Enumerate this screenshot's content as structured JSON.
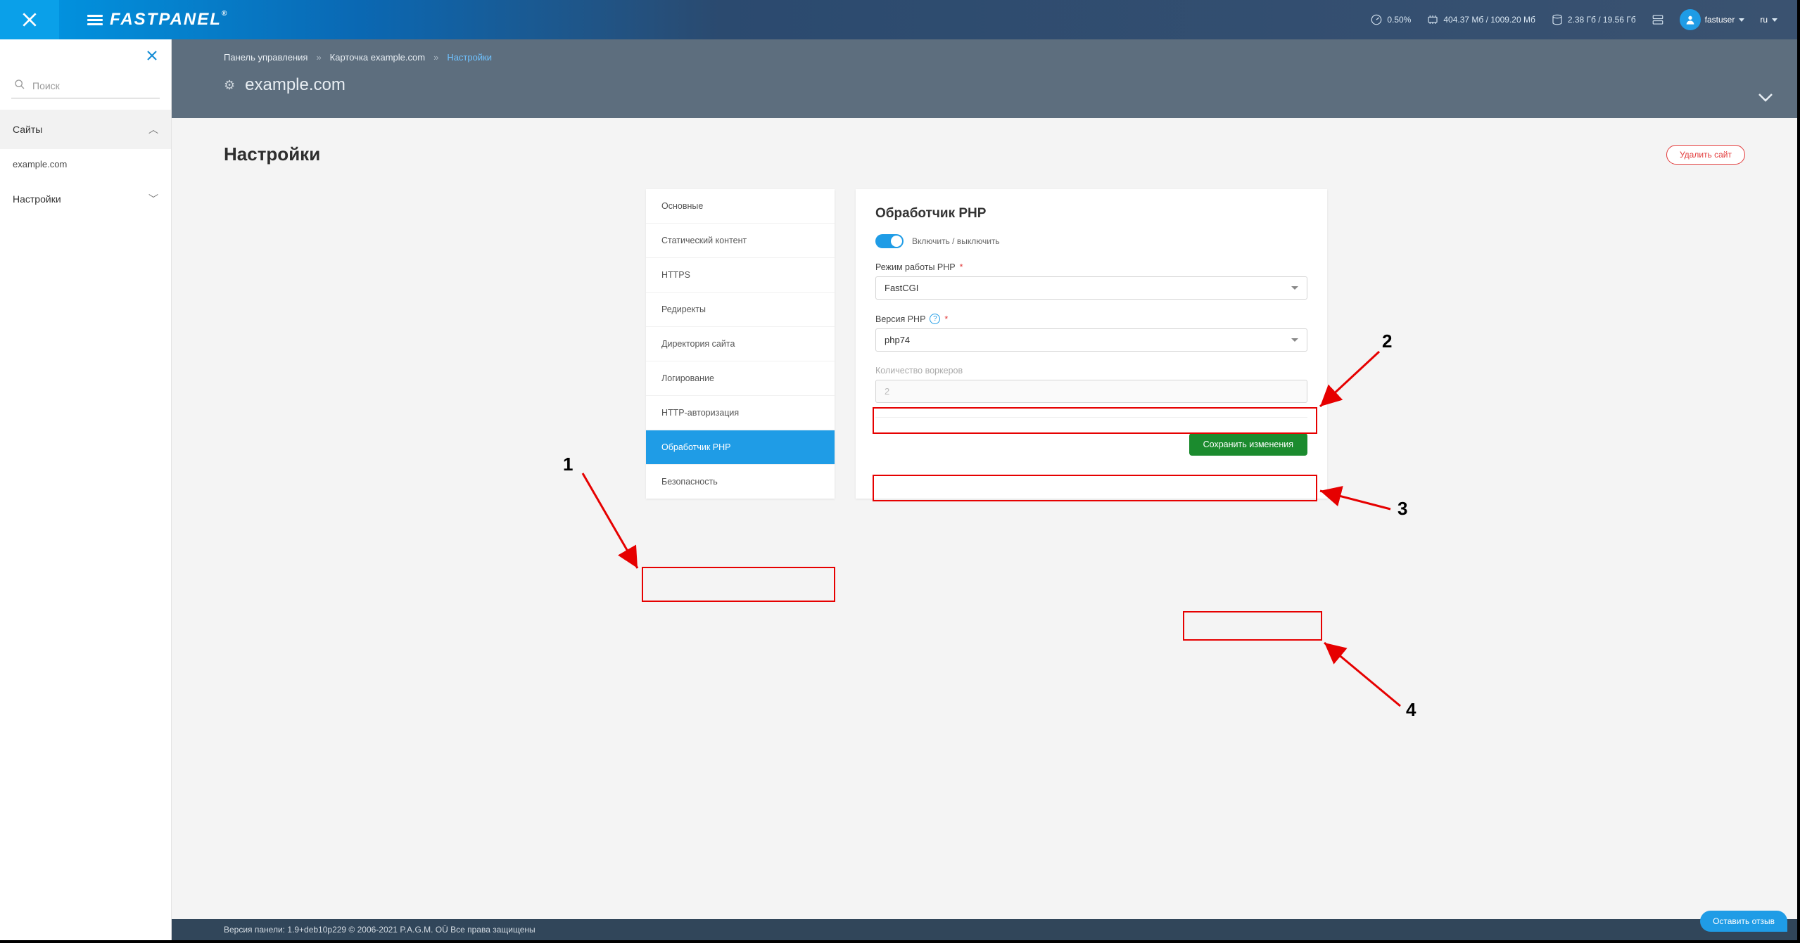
{
  "topbar": {
    "logo_text": "FASTPANEL",
    "cpu_pct": "0.50%",
    "mem": "404.37 Мб / 1009.20 Мб",
    "disk": "2.38 Гб / 19.56 Гб",
    "username": "fastuser",
    "lang": "ru"
  },
  "siteheader": {
    "crumb1": "Панель управления",
    "crumb2": "Карточка example.com",
    "crumb3": "Настройки",
    "site_name": "example.com"
  },
  "sidebar": {
    "search_placeholder": "Поиск",
    "group_sites": "Сайты",
    "site_item": "example.com",
    "group_settings": "Настройки"
  },
  "page": {
    "title": "Настройки",
    "delete_btn": "Удалить сайт"
  },
  "tabs": [
    "Основные",
    "Статический контент",
    "HTTPS",
    "Редиректы",
    "Директория сайта",
    "Логирование",
    "HTTP-авторизация",
    "Обработчик PHP",
    "Безопасность"
  ],
  "form": {
    "heading": "Обработчик PHP",
    "toggle_label": "Включить / выключить",
    "mode_label": "Режим работы PHP",
    "mode_value": "FastCGI",
    "version_label": "Версия PHP",
    "version_value": "php74",
    "workers_label": "Количество воркеров",
    "workers_value": "2",
    "save_btn": "Сохранить изменения"
  },
  "footer": {
    "text": "Версия панели: 1.9+deb10p229 © 2006-2021 P.A.G.M. OÜ Все права защищены"
  },
  "feedback": "Оставить отзыв",
  "annotations": {
    "n1": "1",
    "n2": "2",
    "n3": "3",
    "n4": "4"
  }
}
